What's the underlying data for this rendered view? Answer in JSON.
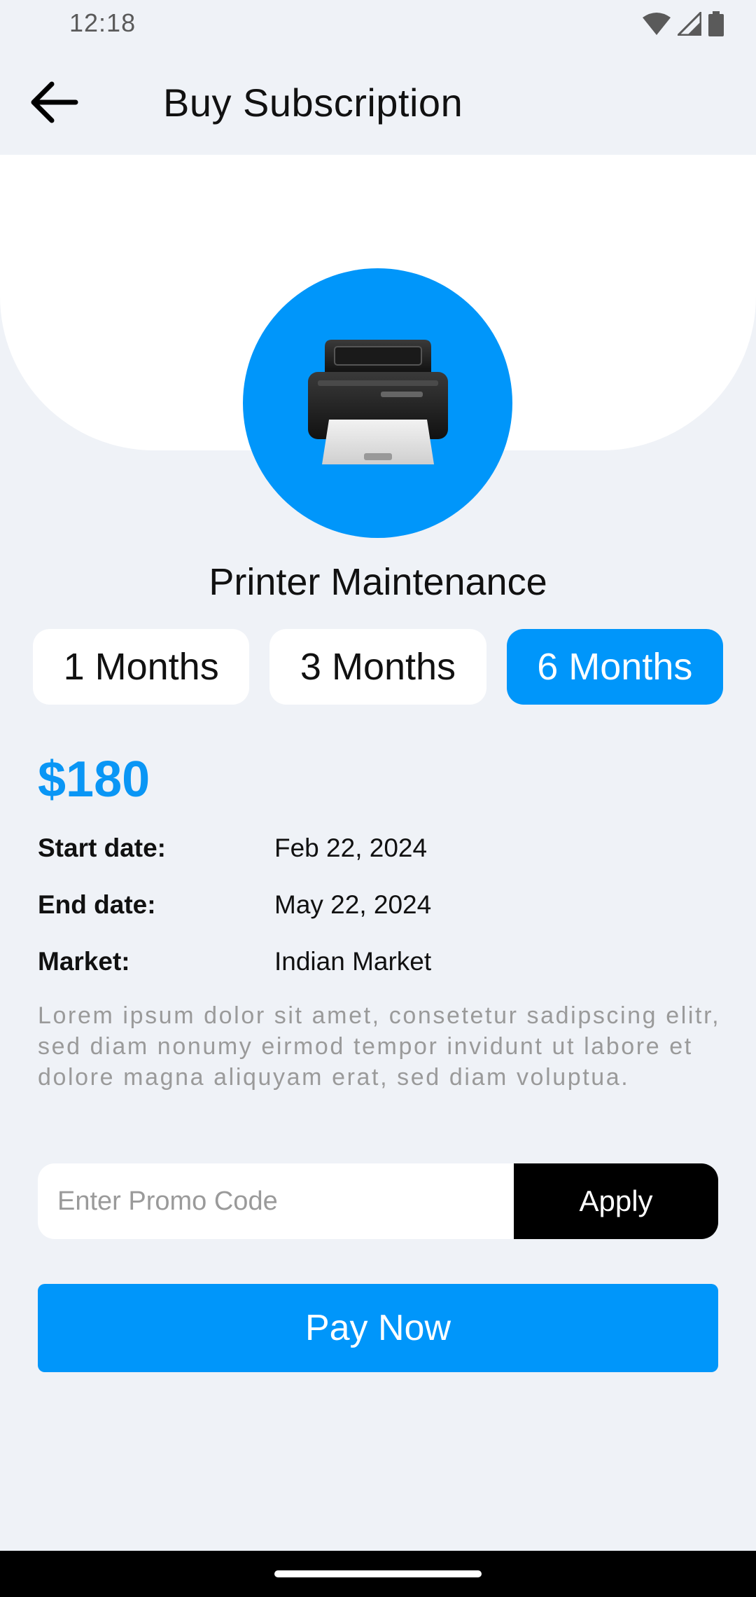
{
  "status_bar": {
    "time": "12:18",
    "icons": [
      "wifi-icon",
      "signal-icon",
      "battery-icon"
    ]
  },
  "app_bar": {
    "back_icon": "arrow-left-icon",
    "title": "Buy Subscription"
  },
  "hero": {
    "icon": "printer-icon",
    "service_name": "Printer Maintenance"
  },
  "plans": [
    {
      "label": "1 Months",
      "selected": false
    },
    {
      "label": "3 Months",
      "selected": false
    },
    {
      "label": "6 Months",
      "selected": true
    }
  ],
  "price": "$180",
  "details": {
    "start_label": "Start date:",
    "start_value": "Feb 22, 2024",
    "end_label": "End date:",
    "end_value": "May 22, 2024",
    "market_label": "Market:",
    "market_value": "Indian Market"
  },
  "description": "Lorem ipsum dolor sit amet, consetetur sadipscing elitr, sed diam nonumy eirmod tempor invidunt ut labore et dolore magna aliquyam erat, sed diam voluptua.",
  "promo": {
    "placeholder": "Enter Promo Code",
    "value": "",
    "apply_label": "Apply"
  },
  "pay_label": "Pay Now",
  "colors": {
    "accent": "#0096fa",
    "background": "#eff2f7",
    "card": "#ffffff",
    "apply": "#000000"
  }
}
